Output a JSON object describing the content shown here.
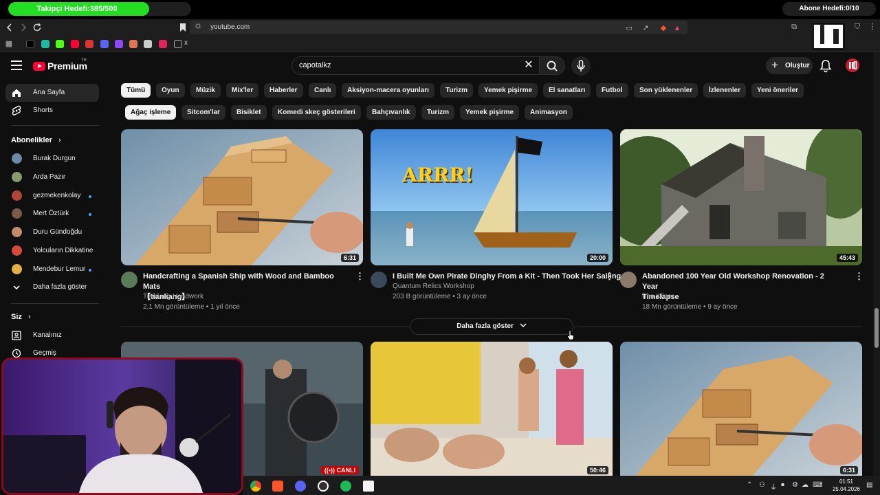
{
  "overlay": {
    "follower_goal": "Takipçi Hedefi:385/500",
    "follower_progress": 0.77,
    "sub_goal": "Abone Hedefi:0/10",
    "sub_progress": 0.0
  },
  "browser": {
    "url": "youtube.com",
    "bookmark_tail": "x"
  },
  "header": {
    "logo_text": "Premium",
    "logo_region": "TR",
    "search_value": "capotalkz",
    "create_label": "Oluştur"
  },
  "sidebar": {
    "home_label": "Ana Sayfa",
    "shorts_label": "Shorts",
    "subs_heading": "Abonelikler",
    "subs_arrow": "›",
    "subscriptions": [
      {
        "name": "Burak Durgun",
        "dot": false,
        "color": "#6b8aa8"
      },
      {
        "name": "Arda Pazır",
        "dot": false,
        "color": "#8a9a6a"
      },
      {
        "name": "gezmekenkolay",
        "dot": true,
        "color": "#b0463a"
      },
      {
        "name": "Mert Öztürk",
        "dot": true,
        "color": "#7a5a48"
      },
      {
        "name": "Duru Gündoğdu",
        "dot": false,
        "color": "#c28a6a"
      },
      {
        "name": "Yolcuların Dikkatine",
        "dot": false,
        "color": "#d64a3a"
      },
      {
        "name": "Mendebur Lemur",
        "dot": true,
        "color": "#e0b040"
      }
    ],
    "show_more_label": "Daha fazla göster",
    "you_heading": "Siz",
    "channel_label": "Kanalınız",
    "history_label": "Geçmiş"
  },
  "chips_row1": [
    "Tümü",
    "Oyun",
    "Müzik",
    "Mix'ler",
    "Haberler",
    "Canlı",
    "Aksiyon-macera oyunları",
    "Turizm",
    "Yemek pişirme",
    "El sanatları",
    "Futbol",
    "Son yüklenenler",
    "İzlenenler",
    "Yeni öneriler"
  ],
  "chips_row2": [
    "Ağaç işleme",
    "Sitcom'lar",
    "Bisiklet",
    "Komedi skeç gösterileri",
    "Bahçıvanlık",
    "Turizm",
    "Yemek pişirme",
    "Animasyon"
  ],
  "videos": [
    {
      "title_line1": "Handcrafting a Spanish Ship with Wood and Bamboo Mats",
      "title_line2": "【tianliang】",
      "channel": "Tianliang Handwork",
      "meta": "2,1 Mn görüntüleme • 1 yıl önce",
      "duration": "6:31"
    },
    {
      "title_line1": "I Built Me Own Pirate Dinghy From a Kit - Then Took Her Sailing",
      "title_line2": "",
      "channel": "Quantum Relics Workshop",
      "meta": "203 B görüntüleme • 3 ay önce",
      "duration": "20:00",
      "overlay_text": "ARRR!"
    },
    {
      "title_line1": "Abandoned 100 Year Old Workshop Renovation - 2 Year",
      "title_line2": "Timelapse",
      "channel": "Ben Kilner",
      "meta": "18 Mn görüntüleme • 9 ay önce",
      "duration": "45:43"
    },
    {
      "live_label": "CANLI"
    },
    {
      "duration": "50:46"
    },
    {
      "duration": "6:31"
    }
  ],
  "show_more_videos": "Daha fazla göster",
  "taskbar": {
    "time": "01:51",
    "date": "25.04.2026"
  }
}
